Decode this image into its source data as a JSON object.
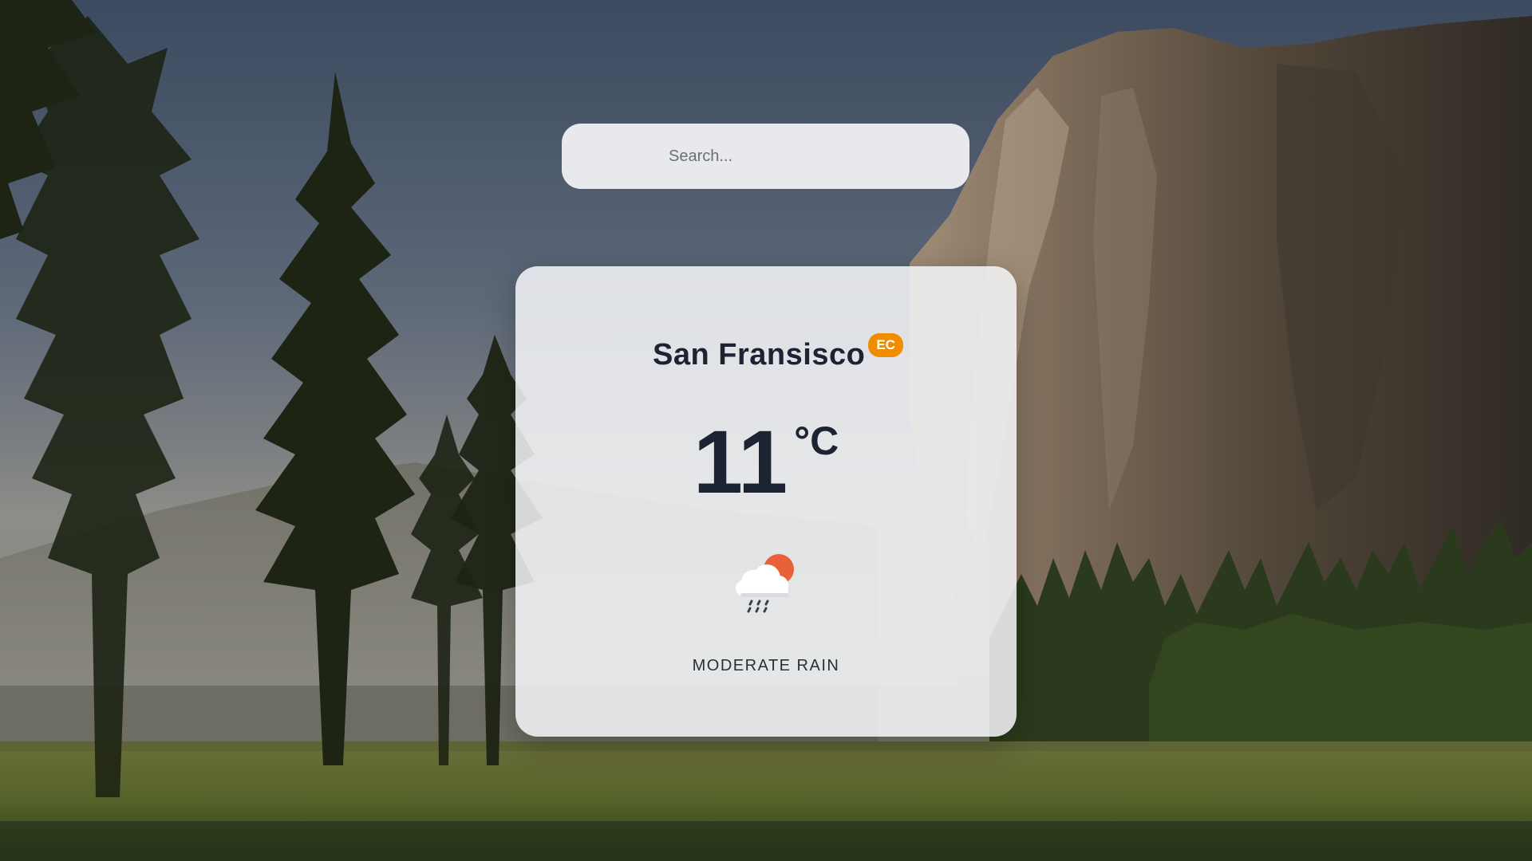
{
  "search": {
    "placeholder": "Search...",
    "value": ""
  },
  "weather": {
    "city": "San Fransisco",
    "country_code": "EC",
    "temperature": "11",
    "unit": "°C",
    "condition": "MODERATE RAIN",
    "icon": "rain-cloud-sun-icon"
  },
  "colors": {
    "badge": "#f08c00",
    "text_dark": "#1c2434",
    "sun": "#e8613a"
  }
}
